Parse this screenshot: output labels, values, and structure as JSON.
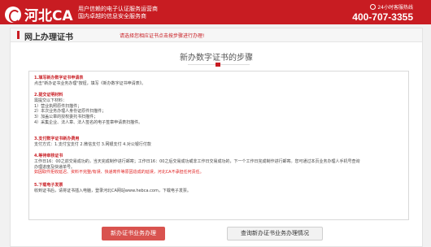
{
  "header": {
    "logo_text": "河北CA",
    "slogan_line1": "用户信赖的电子认证服务运营商",
    "slogan_line2": "国内卓越的信息安全服务商",
    "hotline_label": "24小时客服热线",
    "hotline": "400-707-3355"
  },
  "panel": {
    "title": "网上办理证书",
    "hint": "请选择您相应证书点击按步骤进行办理!"
  },
  "main": {
    "steps_title": "新办数字证书的步骤",
    "steps": [
      {
        "heading": "1.填写新办数字证书申请表",
        "lines": [
          "点击\"新办证书业务办理\"按钮，填写《新办数字证书申请表》。"
        ]
      },
      {
        "heading": "2.提交证明材料",
        "lines": [
          "需提交以下材料：",
          "1）营业执照原件扫描件；",
          "2）本次业务办理人身份证原件扫描件；",
          "3）加盖公章的授权委托书扫描件；",
          "4）采集企业、法人章、法人签名的电子签章申请表扫描件。"
        ]
      },
      {
        "heading": "3.支付数字证书新办费用",
        "lines": [
          "支付方式：1.支付宝支付 2.微信支付 3.网银支付 4.对公银行付款"
        ]
      },
      {
        "heading": "4.等待审核证书",
        "lines": [
          "工作日16：00之前交易成功的，当天完成制作进行邮寄；工作日16：00之后交易成功或非工作日交易成功的，下一个工作日完成制作进行邮寄。您可通过本页业务办理人手机号查询",
          "办理进度及快递单号。"
        ],
        "warning": "如因取件拒收延迟、资料不完整/有误、快递寄件等原因造成的延误，河北CA不承担任何责任。"
      },
      {
        "heading": "5.下载电子发票",
        "lines": [
          "收到证书后，请将证书插入电脑，登录河北CA网站www.hebca.com，下载电子发票。"
        ]
      }
    ]
  },
  "actions": {
    "apply_label": "新办证书业务办理",
    "query_label": "查询新办证书业务办理情况"
  },
  "colors": {
    "brand_red": "#c81c22",
    "button_red": "#d9534f"
  }
}
